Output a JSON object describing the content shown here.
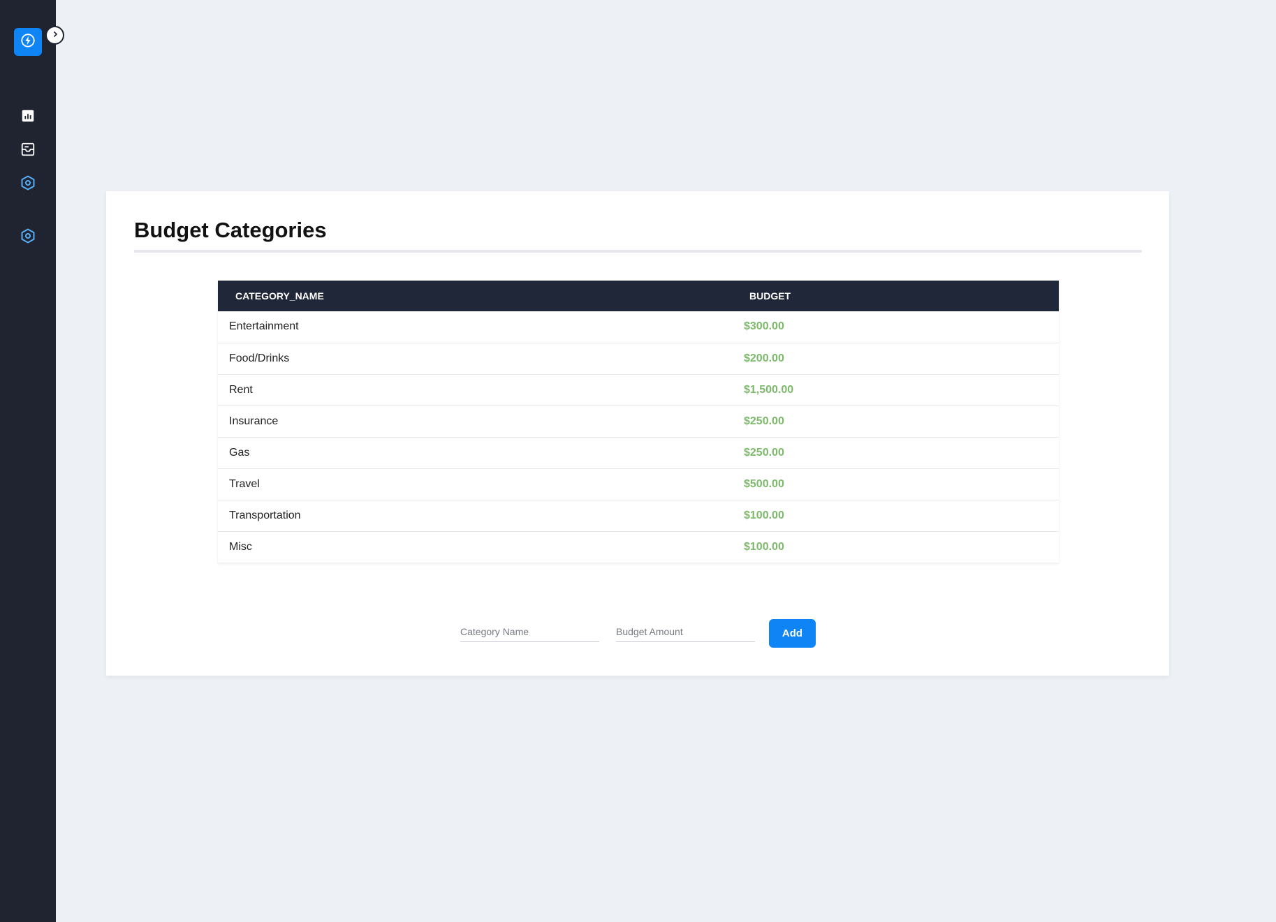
{
  "sidebar": {
    "logo_icon": "lightning-bolt-icon",
    "toggle_icon": "chevron-right-icon",
    "nav_icons": [
      "bar-chart-icon",
      "inbox-icon",
      "settings-hexagon-icon",
      "settings-hexagon-icon"
    ],
    "accent_color": "#0f84f5",
    "background_color": "#1f2430"
  },
  "main": {
    "title": "Budget Categories",
    "table": {
      "headers": {
        "category": "CATEGORY_NAME",
        "budget": "BUDGET"
      },
      "rows": [
        {
          "category": "Entertainment",
          "budget": "$300.00"
        },
        {
          "category": "Food/Drinks",
          "budget": "$200.00"
        },
        {
          "category": "Rent",
          "budget": "$1,500.00"
        },
        {
          "category": "Insurance",
          "budget": "$250.00"
        },
        {
          "category": "Gas",
          "budget": "$250.00"
        },
        {
          "category": "Travel",
          "budget": "$500.00"
        },
        {
          "category": "Transportation",
          "budget": "$100.00"
        },
        {
          "category": "Misc",
          "budget": "$100.00"
        }
      ],
      "header_color": "#1f2738",
      "amount_color": "#7cb96a"
    },
    "form": {
      "category_placeholder": "Category Name",
      "category_value": "",
      "amount_placeholder": "Budget Amount",
      "amount_value": "",
      "add_label": "Add"
    }
  }
}
